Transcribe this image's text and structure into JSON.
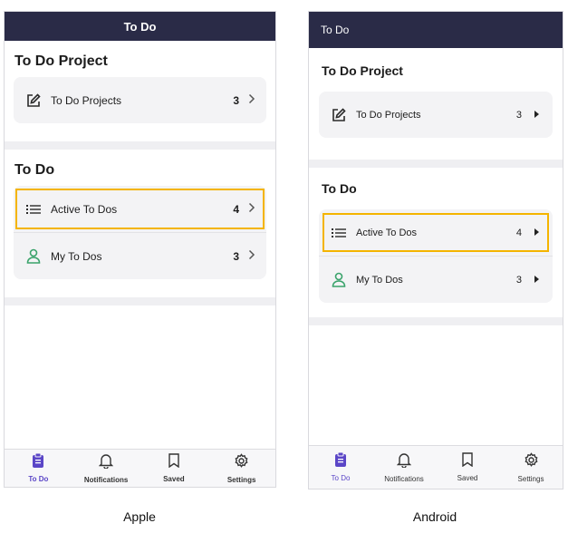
{
  "colors": {
    "header": "#2a2b47",
    "accent": "#5b46c7",
    "highlight": "#f4b400",
    "user_icon": "#3aa36b"
  },
  "apple": {
    "caption": "Apple",
    "header_title": "To Do",
    "project_section_title": "To Do Project",
    "project_row": {
      "label": "To Do Projects",
      "count": "3",
      "icon": "edit-icon"
    },
    "todo_section_title": "To Do",
    "todo_rows": [
      {
        "label": "Active To Dos",
        "count": "4",
        "icon": "list-icon",
        "highlighted": true
      },
      {
        "label": "My To Dos",
        "count": "3",
        "icon": "user-icon"
      }
    ],
    "tabs": [
      {
        "label": "To Do",
        "icon": "clipboard-icon",
        "active": true
      },
      {
        "label": "Notifications",
        "icon": "bell-icon"
      },
      {
        "label": "Saved",
        "icon": "bookmark-icon"
      },
      {
        "label": "Settings",
        "icon": "gear-icon"
      }
    ]
  },
  "android": {
    "caption": "Android",
    "header_title": "To Do",
    "project_section_title": "To Do Project",
    "project_row": {
      "label": "To Do Projects",
      "count": "3",
      "icon": "edit-icon"
    },
    "todo_section_title": "To Do",
    "todo_rows": [
      {
        "label": "Active To Dos",
        "count": "4",
        "icon": "list-icon",
        "highlighted": true
      },
      {
        "label": "My To Dos",
        "count": "3",
        "icon": "user-icon"
      }
    ],
    "tabs": [
      {
        "label": "To Do",
        "icon": "clipboard-icon",
        "active": true
      },
      {
        "label": "Notifications",
        "icon": "bell-icon"
      },
      {
        "label": "Saved",
        "icon": "bookmark-icon"
      },
      {
        "label": "Settings",
        "icon": "gear-icon"
      }
    ]
  }
}
